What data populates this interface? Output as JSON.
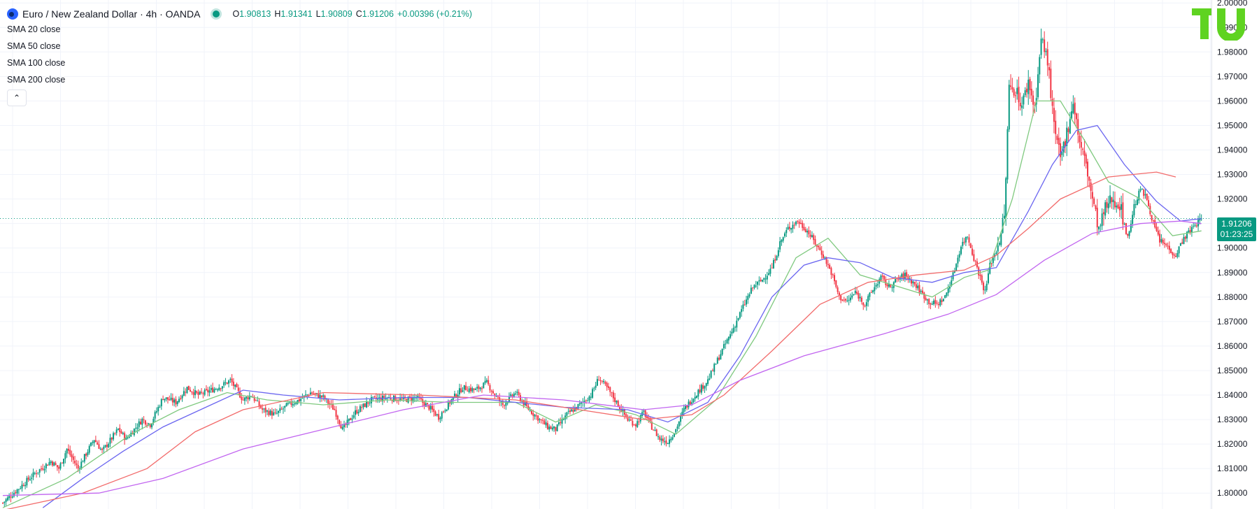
{
  "header": {
    "symbol_title": "Euro / New Zealand Dollar · 4h · OANDA",
    "open_label": "O",
    "open_value": "1.90813",
    "high_label": "H",
    "high_value": "1.91341",
    "low_label": "L",
    "low_value": "1.90809",
    "close_label": "C",
    "close_value": "1.91206",
    "change_value": "+0.00396 (+0.21%)"
  },
  "indicators": [
    "SMA 20 close",
    "SMA 50 close",
    "SMA 100 close",
    "SMA 200 close"
  ],
  "icons": {
    "symbol": "currency-pair-icon",
    "status": "market-status-dot-icon",
    "collapse": "chevron-up-icon",
    "logo": "tradingview-logo-icon"
  },
  "collapse_glyph": "⌃",
  "price_tag": {
    "price": "1.91206",
    "countdown": "01:23:25"
  },
  "colors": {
    "up": "#089981",
    "down": "#f23645",
    "sma20": "#7fc97f",
    "sma50": "#6b66f0",
    "sma100": "#f26b6b",
    "sma200": "#c266f0",
    "grid": "#f0f3fa",
    "text": "#131722",
    "logo": "#5fd321"
  },
  "chart_data": {
    "type": "candlestick",
    "title": "Euro / New Zealand Dollar · 4h · OANDA",
    "timeframe": "4h",
    "ylim": [
      1.7935,
      2.0012
    ],
    "y_ticks": [
      1.8,
      1.81,
      1.82,
      1.83,
      1.84,
      1.85,
      1.86,
      1.87,
      1.88,
      1.89,
      1.9,
      1.91,
      1.92,
      1.93,
      1.94,
      1.95,
      1.96,
      1.97,
      1.98,
      1.99,
      2.0
    ],
    "y_tick_labels": [
      "1.80000",
      "1.81000",
      "1.82000",
      "1.83000",
      "1.84000",
      "1.85000",
      "1.86000",
      "1.87000",
      "1.88000",
      "1.89000",
      "1.90000",
      "1.91000",
      "1.92000",
      "1.93000",
      "1.94000",
      "1.95000",
      "1.96000",
      "1.97000",
      "1.98000",
      "1.99000",
      "2.00000"
    ],
    "last_price": 1.91206,
    "grid": true,
    "close_path": [
      [
        0,
        1.796
      ],
      [
        20,
        1.808
      ],
      [
        30,
        1.813
      ],
      [
        35,
        1.81
      ],
      [
        40,
        1.818
      ],
      [
        47,
        1.81
      ],
      [
        57,
        1.822
      ],
      [
        62,
        1.817
      ],
      [
        72,
        1.826
      ],
      [
        77,
        1.822
      ],
      [
        87,
        1.83
      ],
      [
        92,
        1.828
      ],
      [
        100,
        1.839
      ],
      [
        108,
        1.837
      ],
      [
        115,
        1.843
      ],
      [
        122,
        1.84
      ],
      [
        130,
        1.842
      ],
      [
        137,
        1.844
      ],
      [
        142,
        1.846
      ],
      [
        150,
        1.838
      ],
      [
        155,
        1.84
      ],
      [
        162,
        1.834
      ],
      [
        170,
        1.832
      ],
      [
        178,
        1.836
      ],
      [
        185,
        1.838
      ],
      [
        192,
        1.841
      ],
      [
        200,
        1.839
      ],
      [
        207,
        1.834
      ],
      [
        212,
        1.826
      ],
      [
        220,
        1.833
      ],
      [
        230,
        1.838
      ],
      [
        240,
        1.839
      ],
      [
        250,
        1.838
      ],
      [
        258,
        1.839
      ],
      [
        266,
        1.835
      ],
      [
        272,
        1.831
      ],
      [
        280,
        1.838
      ],
      [
        287,
        1.843
      ],
      [
        295,
        1.842
      ],
      [
        302,
        1.845
      ],
      [
        307,
        1.84
      ],
      [
        312,
        1.836
      ],
      [
        320,
        1.841
      ],
      [
        327,
        1.835
      ],
      [
        335,
        1.83
      ],
      [
        340,
        1.827
      ],
      [
        345,
        1.826
      ],
      [
        352,
        1.832
      ],
      [
        360,
        1.836
      ],
      [
        367,
        1.84
      ],
      [
        372,
        1.847
      ],
      [
        378,
        1.842
      ],
      [
        385,
        1.835
      ],
      [
        390,
        1.83
      ],
      [
        395,
        1.828
      ],
      [
        400,
        1.833
      ],
      [
        405,
        1.827
      ],
      [
        410,
        1.822
      ],
      [
        415,
        1.821
      ],
      [
        420,
        1.826
      ],
      [
        425,
        1.834
      ],
      [
        432,
        1.84
      ],
      [
        440,
        1.846
      ],
      [
        448,
        1.857
      ],
      [
        455,
        1.866
      ],
      [
        462,
        1.876
      ],
      [
        468,
        1.884
      ],
      [
        474,
        1.887
      ],
      [
        480,
        1.892
      ],
      [
        485,
        1.902
      ],
      [
        490,
        1.908
      ],
      [
        496,
        1.911
      ],
      [
        502,
        1.907
      ],
      [
        507,
        1.902
      ],
      [
        512,
        1.897
      ],
      [
        517,
        1.89
      ],
      [
        522,
        1.88
      ],
      [
        527,
        1.878
      ],
      [
        532,
        1.882
      ],
      [
        538,
        1.877
      ],
      [
        543,
        1.883
      ],
      [
        548,
        1.888
      ],
      [
        553,
        1.884
      ],
      [
        558,
        1.887
      ],
      [
        563,
        1.889
      ],
      [
        568,
        1.886
      ],
      [
        573,
        1.882
      ],
      [
        578,
        1.878
      ],
      [
        583,
        1.877
      ],
      [
        588,
        1.88
      ],
      [
        593,
        1.889
      ],
      [
        598,
        1.901
      ],
      [
        602,
        1.905
      ],
      [
        606,
        1.896
      ],
      [
        610,
        1.888
      ],
      [
        613,
        1.882
      ],
      [
        616,
        1.893
      ],
      [
        620,
        1.899
      ],
      [
        625,
        1.912
      ],
      [
        628,
        1.965
      ],
      [
        632,
        1.965
      ],
      [
        636,
        1.958
      ],
      [
        640,
        1.968
      ],
      [
        644,
        1.957
      ],
      [
        648,
        1.985
      ],
      [
        652,
        1.977
      ],
      [
        656,
        1.949
      ],
      [
        660,
        1.936
      ],
      [
        664,
        1.947
      ],
      [
        668,
        1.96
      ],
      [
        672,
        1.943
      ],
      [
        676,
        1.934
      ],
      [
        680,
        1.92
      ],
      [
        684,
        1.907
      ],
      [
        688,
        1.916
      ],
      [
        692,
        1.92
      ],
      [
        697,
        1.918
      ],
      [
        702,
        1.904
      ],
      [
        706,
        1.917
      ],
      [
        710,
        1.924
      ],
      [
        714,
        1.92
      ],
      [
        718,
        1.91
      ],
      [
        722,
        1.903
      ],
      [
        726,
        1.901
      ],
      [
        732,
        1.897
      ],
      [
        736,
        1.903
      ],
      [
        742,
        1.908
      ],
      [
        748,
        1.912
      ]
    ],
    "series": [
      {
        "name": "SMA 20 close",
        "points": [
          [
            0,
            1.794
          ],
          [
            40,
            1.806
          ],
          [
            80,
            1.824
          ],
          [
            110,
            1.834
          ],
          [
            140,
            1.841
          ],
          [
            165,
            1.838
          ],
          [
            200,
            1.836
          ],
          [
            240,
            1.838
          ],
          [
            280,
            1.837
          ],
          [
            320,
            1.837
          ],
          [
            345,
            1.829
          ],
          [
            370,
            1.836
          ],
          [
            395,
            1.832
          ],
          [
            420,
            1.824
          ],
          [
            445,
            1.838
          ],
          [
            470,
            1.864
          ],
          [
            495,
            1.896
          ],
          [
            515,
            1.904
          ],
          [
            535,
            1.889
          ],
          [
            555,
            1.885
          ],
          [
            580,
            1.88
          ],
          [
            600,
            1.888
          ],
          [
            615,
            1.891
          ],
          [
            630,
            1.92
          ],
          [
            645,
            1.96
          ],
          [
            660,
            1.96
          ],
          [
            675,
            1.944
          ],
          [
            690,
            1.927
          ],
          [
            710,
            1.92
          ],
          [
            730,
            1.905
          ],
          [
            748,
            1.907
          ]
        ]
      },
      {
        "name": "SMA 50 close",
        "points": [
          [
            25,
            1.794
          ],
          [
            50,
            1.806
          ],
          [
            75,
            1.817
          ],
          [
            100,
            1.827
          ],
          [
            130,
            1.836
          ],
          [
            150,
            1.842
          ],
          [
            175,
            1.84
          ],
          [
            210,
            1.838
          ],
          [
            250,
            1.839
          ],
          [
            290,
            1.839
          ],
          [
            320,
            1.837
          ],
          [
            350,
            1.835
          ],
          [
            390,
            1.834
          ],
          [
            415,
            1.829
          ],
          [
            440,
            1.837
          ],
          [
            460,
            1.856
          ],
          [
            480,
            1.88
          ],
          [
            500,
            1.893
          ],
          [
            515,
            1.896
          ],
          [
            535,
            1.894
          ],
          [
            555,
            1.888
          ],
          [
            580,
            1.886
          ],
          [
            600,
            1.89
          ],
          [
            620,
            1.892
          ],
          [
            640,
            1.915
          ],
          [
            655,
            1.934
          ],
          [
            670,
            1.948
          ],
          [
            683,
            1.95
          ],
          [
            700,
            1.934
          ],
          [
            720,
            1.919
          ],
          [
            735,
            1.911
          ],
          [
            748,
            1.912
          ]
        ]
      },
      {
        "name": "SMA 100 close",
        "points": [
          [
            0,
            1.793
          ],
          [
            50,
            1.8
          ],
          [
            90,
            1.81
          ],
          [
            120,
            1.825
          ],
          [
            150,
            1.834
          ],
          [
            200,
            1.841
          ],
          [
            260,
            1.84
          ],
          [
            320,
            1.838
          ],
          [
            360,
            1.834
          ],
          [
            400,
            1.83
          ],
          [
            430,
            1.832
          ],
          [
            450,
            1.84
          ],
          [
            480,
            1.858
          ],
          [
            510,
            1.877
          ],
          [
            540,
            1.886
          ],
          [
            570,
            1.889
          ],
          [
            600,
            1.891
          ],
          [
            620,
            1.897
          ],
          [
            640,
            1.908
          ],
          [
            660,
            1.92
          ],
          [
            690,
            1.929
          ],
          [
            720,
            1.931
          ],
          [
            732,
            1.929
          ]
        ]
      },
      {
        "name": "SMA 200 close",
        "points": [
          [
            0,
            1.799
          ],
          [
            60,
            1.8
          ],
          [
            100,
            1.806
          ],
          [
            150,
            1.818
          ],
          [
            200,
            1.826
          ],
          [
            250,
            1.834
          ],
          [
            300,
            1.84
          ],
          [
            350,
            1.838
          ],
          [
            400,
            1.834
          ],
          [
            430,
            1.836
          ],
          [
            460,
            1.846
          ],
          [
            500,
            1.856
          ],
          [
            550,
            1.865
          ],
          [
            590,
            1.873
          ],
          [
            620,
            1.881
          ],
          [
            650,
            1.895
          ],
          [
            680,
            1.906
          ],
          [
            710,
            1.91
          ],
          [
            735,
            1.911
          ],
          [
            748,
            1.91
          ]
        ]
      }
    ]
  }
}
